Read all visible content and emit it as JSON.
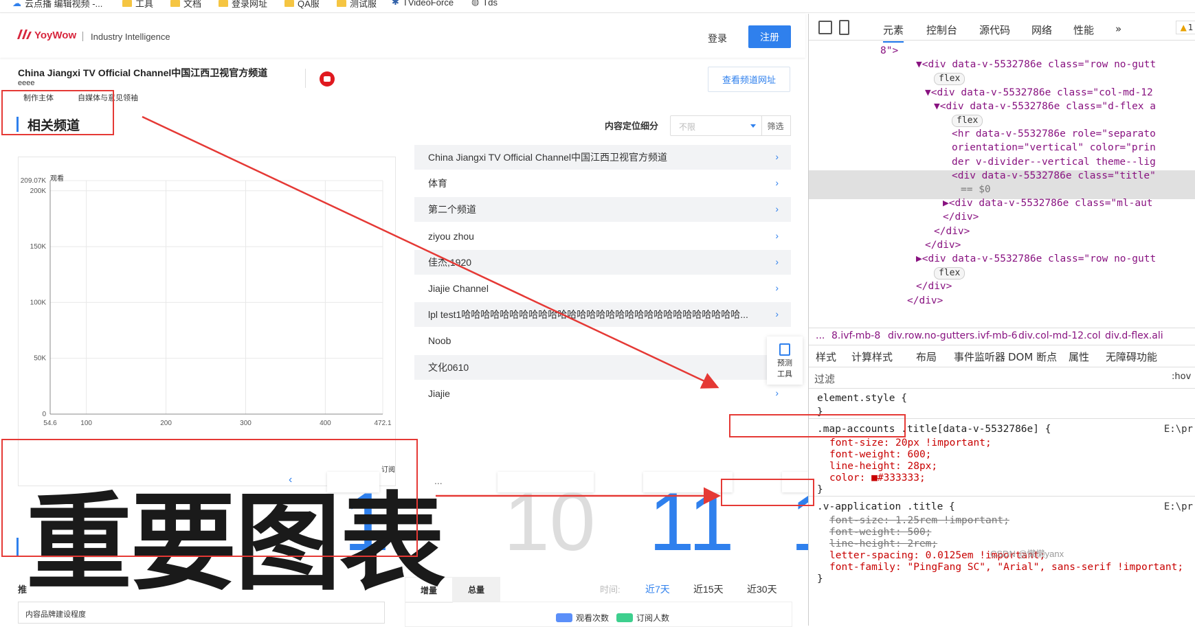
{
  "bookmarks": [
    {
      "label": "云点播 编辑视频 -...",
      "icon": "cloud-icon"
    },
    {
      "label": "工具",
      "icon": "folder-icon"
    },
    {
      "label": "文档",
      "icon": "folder-icon"
    },
    {
      "label": "登录网址",
      "icon": "folder-icon"
    },
    {
      "label": "QA服",
      "icon": "folder-icon"
    },
    {
      "label": "测试服",
      "icon": "folder-icon"
    },
    {
      "label": "TVideoForce",
      "icon": "gear-icon"
    },
    {
      "label": "Tds",
      "icon": "globe-icon"
    }
  ],
  "header": {
    "brand": "YoyWow",
    "brand_sub": "Industry Intelligence",
    "login": "登录",
    "register": "注册",
    "brand_color": "#d7263d",
    "accent": "#2f80ed"
  },
  "channel": {
    "title": "China Jiangxi TV Official Channel中国江西卫视官方频道",
    "subtitle": "eeee",
    "view_url": "查看频道网址",
    "meta_tabs": [
      "制作主体",
      "自媒体与意见领袖"
    ]
  },
  "related": {
    "title": "相关频道",
    "filter_label": "内容定位细分",
    "filter_placeholder": "不限",
    "filter_button": "筛选",
    "items": [
      "China Jiangxi TV Official Channel中国江西卫视官方频道",
      "体育",
      "第二个频道",
      "ziyou zhou",
      "佳杰,1920",
      "Jiajie Channel",
      "lpl test1哈哈哈哈哈哈哈哈哈哈哈哈哈哈哈哈哈哈哈哈哈哈哈哈哈哈哈哈哈...",
      "Noob",
      "文化0610",
      "Jiajie"
    ]
  },
  "float_tool": {
    "label_line1": "预测",
    "label_line2": "工具"
  },
  "chart_data": {
    "type": "scatter",
    "title": "",
    "xlabel": "订阅",
    "ylabel": "观看",
    "x_ticks": [
      "54.6",
      "100",
      "200",
      "300",
      "400",
      "472.1"
    ],
    "y_ticks": [
      "0",
      "50K",
      "100K",
      "150K",
      "200K",
      "209.07K"
    ],
    "xlim": [
      54.6,
      472.1
    ],
    "ylim": [
      0,
      209070
    ],
    "series": [],
    "grid": true
  },
  "carousel": {
    "numbers": [
      "1",
      "10",
      "11",
      "1"
    ],
    "prev": "‹",
    "dots": "..."
  },
  "overlay_text": "重要图表",
  "bottom": {
    "rec_label": "推",
    "rec_box": "内容品牌建设程度",
    "tab_increment": "增量",
    "tab_total": "总量",
    "time_label": "时间:",
    "time_options": [
      "近7天",
      "近15天",
      "近30天"
    ],
    "legend": [
      {
        "name": "观看次数",
        "color": "#5b8ff9"
      },
      {
        "name": "订阅人数",
        "color": "#3ecf8e"
      }
    ]
  },
  "devtools": {
    "tabs": [
      "元素",
      "控制台",
      "源代码",
      "网络",
      "性能",
      "»"
    ],
    "warning_count": "1",
    "dom_lines": [
      "8\">",
      "▼<div data-v-5532786e class=\"row no-gutt",
      "flex",
      "▼<div data-v-5532786e class=\"col-md-12",
      "▼<div data-v-5532786e class=\"d-flex a",
      "flex",
      "<hr data-v-5532786e role=\"separato",
      "orientation=\"vertical\" color=\"prin",
      "der v-divider--vertical theme--lig",
      "<div data-v-5532786e class=\"title\"",
      "== $0",
      "▶<div data-v-5532786e class=\"ml-aut",
      "</div>",
      "</div>",
      "</div>",
      "▶<div data-v-5532786e class=\"row no-gutt",
      "flex",
      "</div>",
      "</div>"
    ],
    "breadcrumbs": [
      "...",
      "8.ivf-mb-8",
      "div.row.no-gutters.ivf-mb-6",
      "div.col-md-12.col",
      "div.d-flex.ali"
    ],
    "subtabs": [
      "样式",
      "计算样式",
      "布局",
      "事件监听器",
      "DOM 断点",
      "属性",
      "无障碍功能"
    ],
    "filter_placeholder": "过滤",
    "hov": ":hov",
    "rules": [
      {
        "selector": "element.style {",
        "close": "}"
      },
      {
        "selector": ".map-accounts .title[data-v-5532786e] {",
        "source": "E:\\pr",
        "decls": [
          "font-size: 20px !important;",
          "font-weight: 600;",
          "line-height: 28px;",
          "color: ■#333333;"
        ],
        "close": "}"
      },
      {
        "selector": ".v-application .title {",
        "source": "E:\\pr",
        "decls": [
          "font-size: 1.25rem !important;",
          "font-weight: 500;",
          "line-height: 2rem;",
          "letter-spacing: 0.0125em !important;",
          "font-family: \"PingFang SC\", \"Arial\", sans-serif !important;"
        ],
        "close": "}"
      }
    ]
  },
  "watermark": "CSDN @懒懒yanx"
}
